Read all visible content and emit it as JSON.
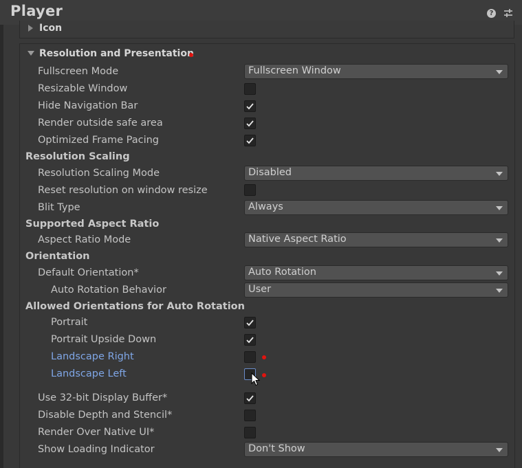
{
  "header": {
    "title": "Player",
    "help_glyph": "?"
  },
  "icon_section": {
    "title": "Icon"
  },
  "resolution_section": {
    "title": "Resolution and Presentation"
  },
  "fields": {
    "fullscreen_mode": {
      "label": "Fullscreen Mode",
      "value": "Fullscreen Window"
    },
    "resizable_window": {
      "label": "Resizable Window",
      "checked": false
    },
    "hide_navigation_bar": {
      "label": "Hide Navigation Bar",
      "checked": true
    },
    "render_outside_safe_area": {
      "label": "Render outside safe area",
      "checked": true
    },
    "optimized_frame_pacing": {
      "label": "Optimized Frame Pacing",
      "checked": true
    },
    "resolution_scaling_header": "Resolution Scaling",
    "resolution_scaling_mode": {
      "label": "Resolution Scaling Mode",
      "value": "Disabled"
    },
    "reset_resolution": {
      "label": "Reset resolution on window resize",
      "checked": false
    },
    "blit_type": {
      "label": "Blit Type",
      "value": "Always"
    },
    "supported_aspect_header": "Supported Aspect Ratio",
    "aspect_ratio_mode": {
      "label": "Aspect Ratio Mode",
      "value": "Native Aspect Ratio"
    },
    "orientation_header": "Orientation",
    "default_orientation": {
      "label": "Default Orientation*",
      "value": "Auto Rotation"
    },
    "auto_rotation_behavior": {
      "label": "Auto Rotation Behavior",
      "value": "User"
    },
    "allowed_orientations_header": "Allowed Orientations for Auto Rotation",
    "portrait": {
      "label": "Portrait",
      "checked": true
    },
    "portrait_upside_down": {
      "label": "Portrait Upside Down",
      "checked": true
    },
    "landscape_right": {
      "label": "Landscape Right",
      "checked": false
    },
    "landscape_left": {
      "label": "Landscape Left",
      "checked": false
    },
    "use_32bit_buffer": {
      "label": "Use 32-bit Display Buffer*",
      "checked": true
    },
    "disable_depth_stencil": {
      "label": "Disable Depth and Stencil*",
      "checked": false
    },
    "render_over_native_ui": {
      "label": "Render Over Native UI*",
      "checked": false
    },
    "show_loading_indicator": {
      "label": "Show Loading Indicator",
      "value": "Don't Show"
    }
  },
  "colors": {
    "background": "#383838",
    "field_bg": "#515151",
    "checkbox_bg": "#252525",
    "modified_dot": "#e0140f",
    "hover_label": "#7fa6e6"
  }
}
